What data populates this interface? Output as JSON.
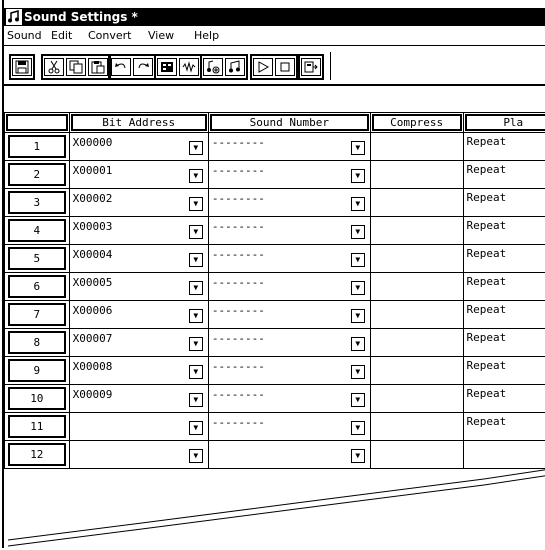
{
  "window": {
    "title": "Sound Settings *"
  },
  "menu": [
    {
      "label": "Sound"
    },
    {
      "label": "Edit"
    },
    {
      "label": "Convert"
    },
    {
      "label": "View"
    },
    {
      "label": "Help"
    }
  ],
  "toolbar": {
    "groups": [
      [
        "save-icon"
      ],
      [
        "cut-icon",
        "copy-icon",
        "paste-icon"
      ],
      [
        "undo-icon",
        "redo-icon"
      ],
      [
        "table-icon",
        "waveform-icon"
      ],
      [
        "sound-add-icon",
        "sound-icon"
      ],
      [
        "play-icon",
        "stop-icon"
      ],
      [
        "export-icon"
      ]
    ]
  },
  "grid": {
    "headers": [
      "",
      "Bit Address",
      "Sound Number",
      "Compress",
      "Pla"
    ],
    "rows": [
      {
        "num": "1",
        "address": "X00000",
        "sound": "--------",
        "play": "Repeat"
      },
      {
        "num": "2",
        "address": "X00001",
        "sound": "--------",
        "play": "Repeat"
      },
      {
        "num": "3",
        "address": "X00002",
        "sound": "--------",
        "play": "Repeat"
      },
      {
        "num": "4",
        "address": "X00003",
        "sound": "--------",
        "play": "Repeat"
      },
      {
        "num": "5",
        "address": "X00004",
        "sound": "--------",
        "play": "Repeat"
      },
      {
        "num": "6",
        "address": "X00005",
        "sound": "--------",
        "play": "Repeat"
      },
      {
        "num": "7",
        "address": "X00006",
        "sound": "--------",
        "play": "Repeat"
      },
      {
        "num": "8",
        "address": "X00007",
        "sound": "--------",
        "play": "Repeat"
      },
      {
        "num": "9",
        "address": "X00008",
        "sound": "--------",
        "play": "Repeat"
      },
      {
        "num": "10",
        "address": "X00009",
        "sound": "--------",
        "play": "Repeat"
      },
      {
        "num": "11",
        "address": "",
        "sound": "--------",
        "play": "Repeat"
      },
      {
        "num": "12",
        "address": "",
        "sound": "",
        "play": ""
      }
    ]
  }
}
